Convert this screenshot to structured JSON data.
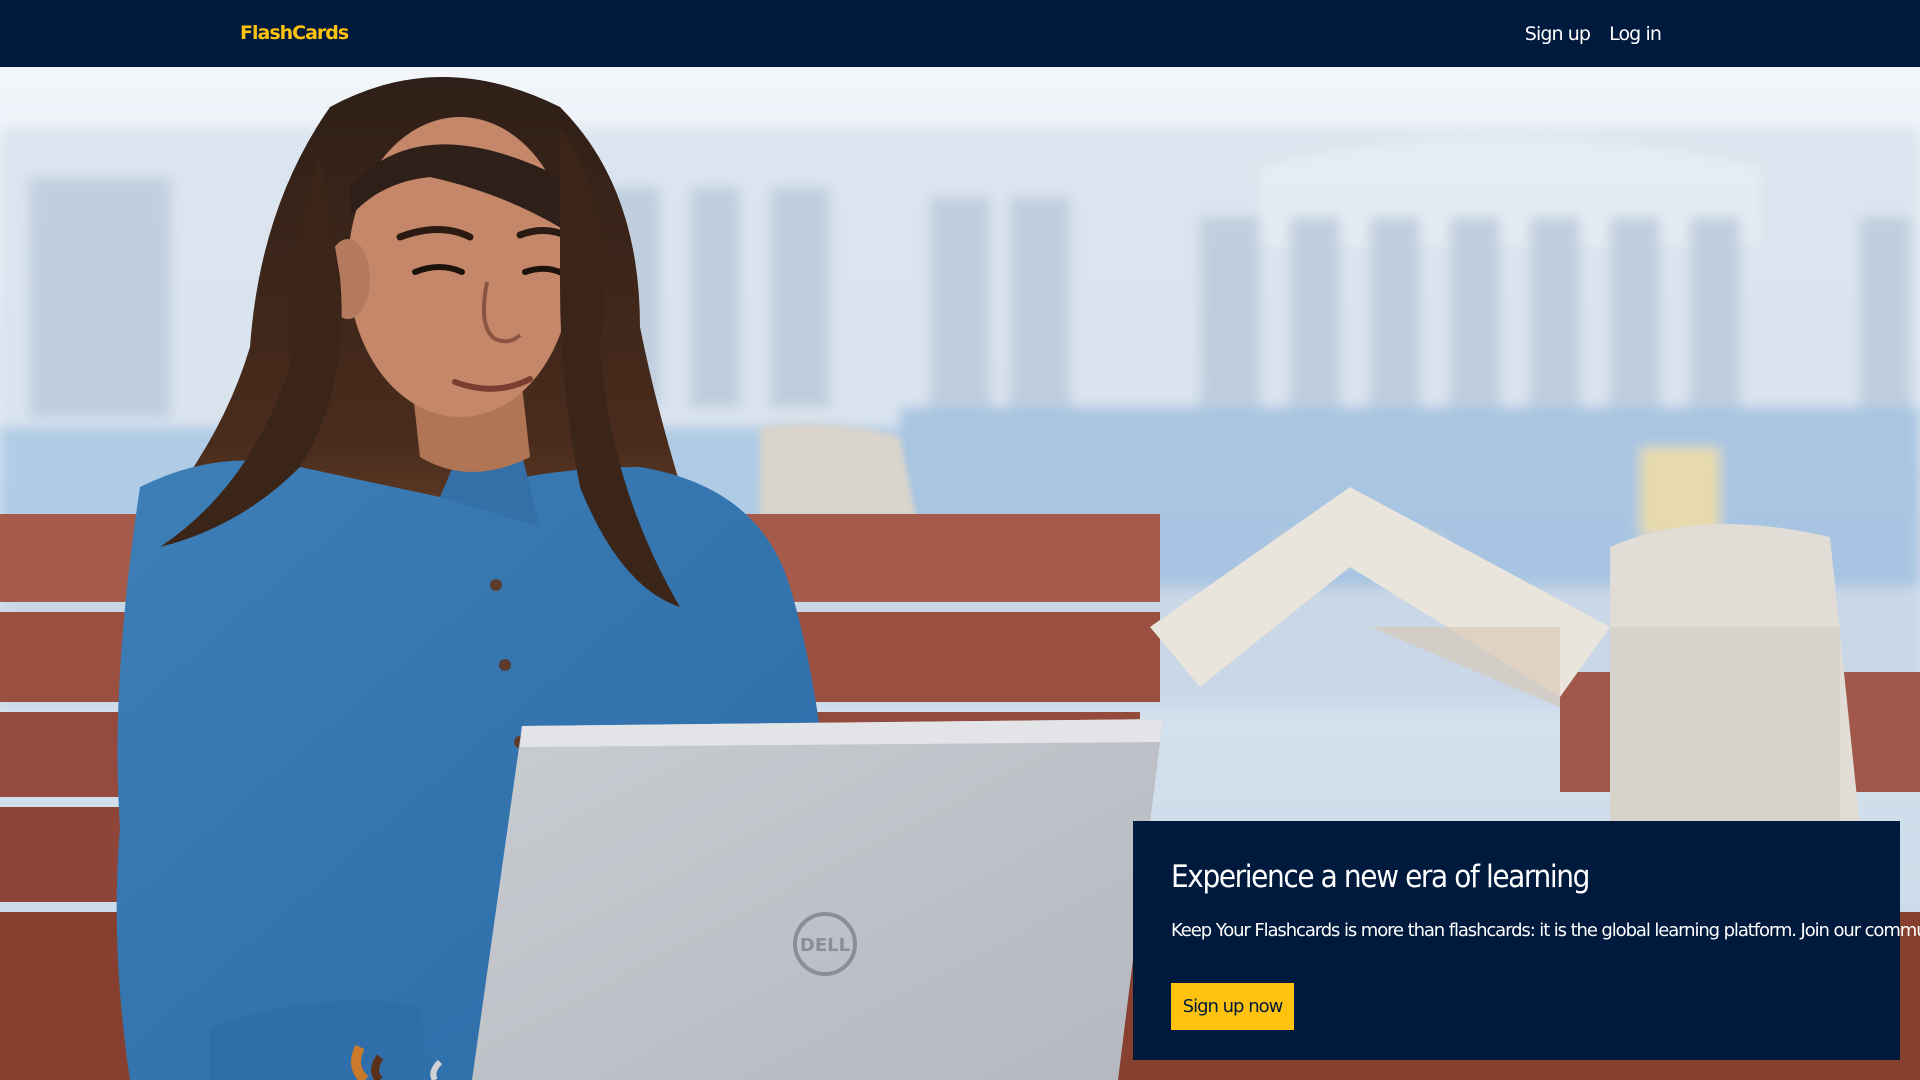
{
  "header": {
    "brand": "FlashCards",
    "nav": [
      {
        "label": "Sign up"
      },
      {
        "label": "Log in"
      }
    ]
  },
  "hero": {
    "image": {
      "description_icon": "photo-student-laptop",
      "laptop_logo": "DELL"
    }
  },
  "cta": {
    "title": "Experience a new era of learning",
    "text": "Keep Your Flashcards is more than flashcards: it is the global learning platform. Join our community.",
    "button_label": "Sign up now"
  },
  "colors": {
    "navy": "#001a3d",
    "accent": "#ffc20e",
    "white": "#ffffff"
  }
}
